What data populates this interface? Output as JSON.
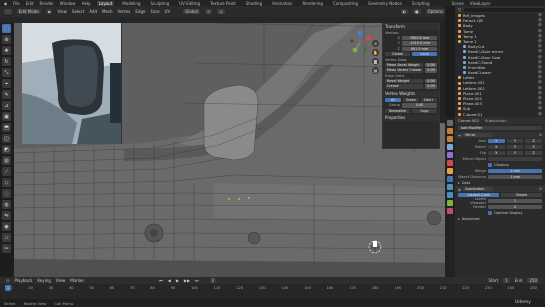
{
  "menu": [
    "File",
    "Edit",
    "Render",
    "Window",
    "Help"
  ],
  "workspaces": [
    "Layout",
    "Modeling",
    "Sculpting",
    "UV Editing",
    "Texture Paint",
    "Shading",
    "Animation",
    "Rendering",
    "Compositing",
    "Geometry Nodes",
    "Scripting"
  ],
  "scene_label": "Scene",
  "viewlayer_label": "ViewLayer",
  "header": {
    "mode": "Edit Mode",
    "view_menus": [
      "View",
      "Select",
      "Add",
      "Mesh",
      "Vertex",
      "Edge",
      "Face",
      "UV"
    ],
    "orientation": "Global",
    "options": "Options"
  },
  "npanel": {
    "title": "Transform",
    "median": "Median:",
    "axes": [
      {
        "label": "X",
        "value": "7635.8 mm"
      },
      {
        "label": "Y",
        "value": "-1019.5 mm"
      },
      {
        "label": "Z",
        "value": "891.9 mm"
      }
    ],
    "global_label": "Global",
    "local_label": "Local",
    "vertex_data_title": "Vertex Data:",
    "mean_bevel_weight": "Mean Bevel Weight",
    "mean_vertex_crease": "Mean Vertex Crease",
    "edges_title": "Edge Data:",
    "bevel_weight": "Bevel Weight",
    "crease": "Crease",
    "zero": "0.00",
    "vertex_weights_title": "Vertex Weights",
    "weight_modes": [
      "All",
      "Green",
      "Dev+"
    ],
    "vgroup": "Group",
    "vgroup_value": "0.00",
    "normalize": "Normalize",
    "copy": "Copy",
    "properties_title": "Properties"
  },
  "outliner": {
    "items": [
      {
        "name": "Ref_images",
        "color": "#e8a04a"
      },
      {
        "name": "Ferox1-QB",
        "color": "#e8a04a"
      },
      {
        "name": "Body",
        "color": "#e8a04a"
      },
      {
        "name": "Tome",
        "color": "#e8a04a"
      },
      {
        "name": "Temp 1",
        "color": "#e8a04a"
      },
      {
        "name": "Tome 2",
        "color": "#e8a04a"
      },
      {
        "name": "BodyCut",
        "color": "#7aa6e0"
      },
      {
        "name": "fixedC-Door mirror",
        "color": "#7aa6e0"
      },
      {
        "name": "fixedC-Door Oval",
        "color": "#7aa6e0"
      },
      {
        "name": "fixedC-Stand",
        "color": "#7aa6e0"
      },
      {
        "name": "Emmitter",
        "color": "#7aa6e0"
      },
      {
        "name": "fixedCLower",
        "color": "#7aa6e0"
      },
      {
        "name": "Letter",
        "color": "#e8a04a"
      },
      {
        "name": "Letters.001",
        "color": "#e8a04a"
      },
      {
        "name": "Letters.002",
        "color": "#e8a04a"
      },
      {
        "name": "Plane.001",
        "color": "#e8a04a"
      },
      {
        "name": "Plane.002",
        "color": "#e8a04a"
      },
      {
        "name": "Plane.003",
        "color": "#e8a04a"
      },
      {
        "name": "Sub",
        "color": "#e8a04a"
      },
      {
        "name": "C.bone.01",
        "color": "#e8a04a"
      }
    ]
  },
  "properties": {
    "object_name": "Corner.002",
    "modifier_tab": "Subdivision",
    "add_modifier": "Add Modifier",
    "mirror_name": "Mirror",
    "axis_label": "Axis",
    "bisect_label": "Bisect",
    "flip_label": "Flip",
    "mirror_object": "Mirror Object",
    "clipping": "Clipping",
    "merge_label": "Merge",
    "merge_value": "1 mm",
    "bisect_distance": "Bisect Distance",
    "bisect_distance_value": "1 mm",
    "data_label": "Data",
    "subdiv_name": "Subdivision",
    "catmull": "Catmull-Clark",
    "simple": "Simple",
    "levels_viewport": "Levels Viewport",
    "levels_viewport_value": "1",
    "render": "Render",
    "render_value": "2",
    "optimal": "Optimal Display",
    "advanced": "Advanced",
    "xyz": [
      "X",
      "Y",
      "Z"
    ]
  },
  "timeline": {
    "menus": [
      "Playback",
      "Keying",
      "View",
      "Marker"
    ],
    "frame": "1",
    "start_label": "Start",
    "start": "1",
    "end_label": "End",
    "end": "250",
    "ticks": [
      "10",
      "20",
      "30",
      "40",
      "50",
      "60",
      "70",
      "80",
      "90",
      "100",
      "110",
      "120",
      "130",
      "140",
      "150",
      "160",
      "170",
      "180",
      "190",
      "200",
      "210",
      "220",
      "230",
      "240",
      "250"
    ]
  },
  "status": {
    "select": "Select",
    "rotate": "Rotate View",
    "menu": "Call Menu"
  },
  "watermark": "Udemy",
  "colors": {
    "accent": "#4772b3",
    "vertex": "#e8a04a",
    "mesh": "#7aa6e0"
  }
}
